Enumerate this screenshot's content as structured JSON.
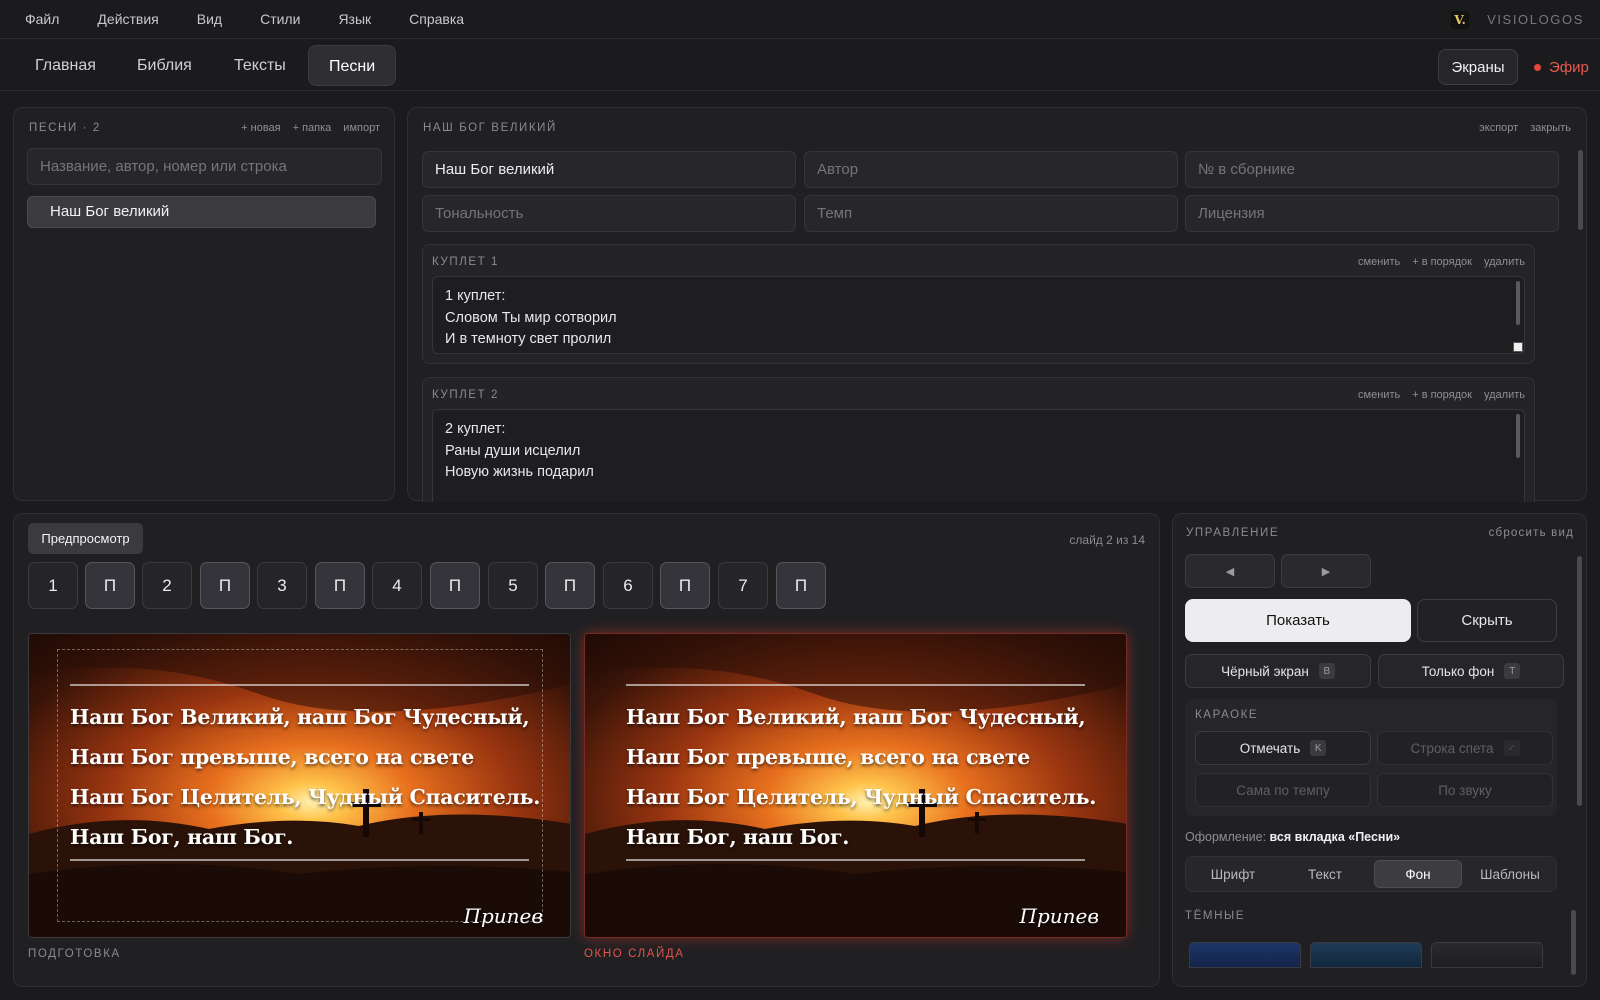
{
  "menu": [
    "Файл",
    "Действия",
    "Вид",
    "Стили",
    "Язык",
    "Справка"
  ],
  "brand": {
    "logo": "V.",
    "name": "VISIOLOGOS"
  },
  "tabs": [
    "Главная",
    "Библия",
    "Тексты",
    "Песни"
  ],
  "active_tab": "Песни",
  "header_right": {
    "screens": "Экраны",
    "onair": "Эфир"
  },
  "songs_panel": {
    "title": "ПЕСНИ · 2",
    "links": [
      "+ новая",
      "+ папка",
      "импорт"
    ],
    "search_placeholder": "Название, автор, номер или строка",
    "items": [
      "Наш Бог великий"
    ]
  },
  "editor": {
    "title": "НАШ БОГ ВЕЛИКИЙ",
    "links": [
      "экспорт",
      "закрыть"
    ],
    "fields": {
      "name": "Наш Бог великий",
      "author_ph": "Автор",
      "number_ph": "№ в сборнике",
      "key_ph": "Тональность",
      "tempo_ph": "Темп",
      "license_ph": "Лицензия"
    },
    "verses": [
      {
        "title": "КУПЛЕТ 1",
        "lines": [
          "1 куплет:",
          "Словом Ты мир сотворил",
          "И в темноту свет пролил"
        ]
      },
      {
        "title": "КУПЛЕТ 2",
        "lines": [
          "2 куплет:",
          "Раны души исцелил",
          "Новую жизнь подарил"
        ]
      }
    ],
    "verse_links": [
      "сменить",
      "+ в порядок",
      "удалить"
    ]
  },
  "slides": {
    "preview_label": "Предпросмотр",
    "count": "слайд 2 из 14",
    "thumbs": [
      "1",
      "П",
      "2",
      "П",
      "3",
      "П",
      "4",
      "П",
      "5",
      "П",
      "6",
      "П",
      "7",
      "П"
    ],
    "lyrics": [
      "Наш Бог Великий, наш Бог Чудесный,",
      "Наш Бог превыше, всего на свете",
      "Наш Бог Целитель, Чудный Спаситель.",
      "Наш Бог, наш Бог."
    ],
    "slide_label": "Припев",
    "prep_caption": "ПОДГОТОВКА",
    "live_caption": "ОКНО СЛАЙДА",
    "live_caption_color": "#e5534b"
  },
  "control": {
    "title": "УПРАВЛЕНИЕ",
    "reset": "сбросить вид",
    "prev": "◀",
    "next": "▶",
    "show": "Показать",
    "hide": "Скрыть",
    "black_screen": "Чёрный экран",
    "black_key": "B",
    "bg_only": "Только фон",
    "bg_key": "T",
    "karaoke_title": "КАРАОКЕ",
    "mark": "Отмечать",
    "mark_key": "K",
    "sung_line": "Строка спета",
    "sung_key": "✓",
    "self_tempo": "Сама по темпу",
    "by_sound": "По звуку",
    "design_label": "Оформление:",
    "design_value": "вся вкладка «Песни»",
    "segments": [
      "Шрифт",
      "Текст",
      "Фон",
      "Шаблоны"
    ],
    "active_segment": "Фон",
    "group_title": "ТЁМНЫЕ",
    "swatch_colors": [
      "#1d3566",
      "#1e3b55",
      "#2a2a2e"
    ]
  }
}
